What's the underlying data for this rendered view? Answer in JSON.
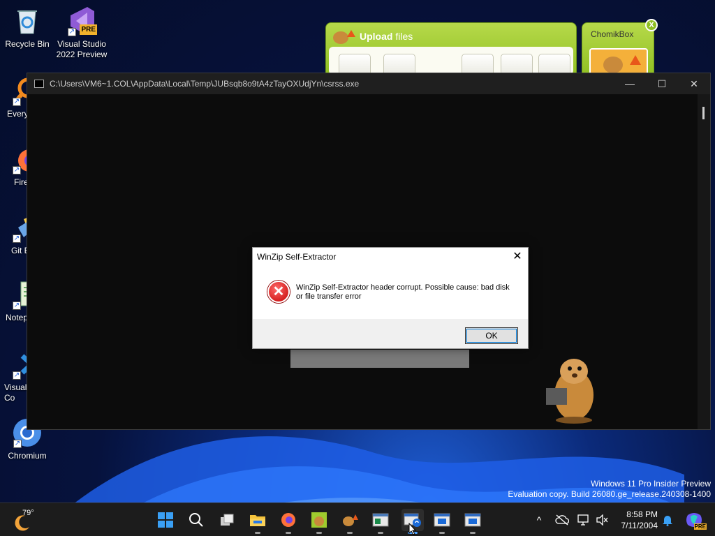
{
  "desktop": {
    "icons": [
      {
        "label": "Recycle Bin",
        "icon": "recycle-bin-icon"
      },
      {
        "label": "Visual Studio 2022 Preview",
        "icon": "visual-studio-icon",
        "badge": "PRE"
      },
      {
        "label": "Every",
        "icon": "everything-icon"
      },
      {
        "label": "Fire",
        "icon": "firefox-icon"
      },
      {
        "label": "Git B",
        "icon": "git-bash-icon"
      },
      {
        "label": "Notep",
        "icon": "notepad-icon"
      },
      {
        "label": "Visual Co",
        "icon": "vscode-icon"
      },
      {
        "label": "Chromium",
        "icon": "chromium-icon"
      }
    ]
  },
  "chomikbox": {
    "upload_title_bold": "Upload",
    "upload_title_rest": " files",
    "panel_title": "ChomikBox",
    "close_label": "X"
  },
  "console": {
    "title": "C:\\Users\\VM6~1.COL\\AppData\\Local\\Temp\\JUBsqb8o9tA4zTayOXUdjYn\\csrss.exe",
    "minimize": "—",
    "maximize": "☐",
    "close": "✕"
  },
  "dialog": {
    "title": "WinZip Self-Extractor",
    "close": "✕",
    "message": "WinZip Self-Extractor header corrupt.  Possible cause:  bad disk or file transfer error",
    "ok_label": "OK",
    "error_glyph": "✕"
  },
  "watermark": {
    "line1": "Windows 11 Pro Insider Preview",
    "line2": "Evaluation copy. Build 26080.ge_release.240308-1400"
  },
  "taskbar": {
    "weather_temp": "79°",
    "apps": [
      "start-icon",
      "search-icon",
      "task-view-icon",
      "file-explorer-icon",
      "firefox-icon",
      "chomikbox-icon",
      "chomikbox-upload-icon",
      "window-icon",
      "winzip-icon",
      "window-icon",
      "window-icon"
    ],
    "time": "8:58 PM",
    "date": "7/11/2004",
    "tray_chevron": "^"
  },
  "colors": {
    "accent": "#0078d7",
    "chomik_green": "#9fcb2e",
    "error_red": "#d40000"
  }
}
